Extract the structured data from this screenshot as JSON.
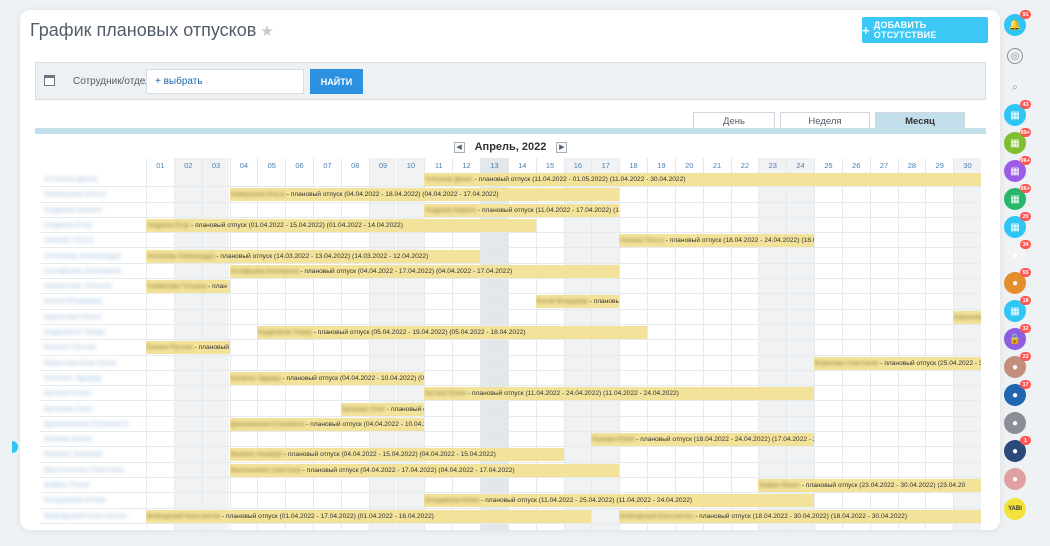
{
  "header": {
    "title": "График плановых отпусков",
    "add_label": "ДОБАВИТЬ ОТСУТСТВИЕ"
  },
  "filter": {
    "label": "Сотрудник/отдел:",
    "select_placeholder": "+ выбрать",
    "find_label": "НАЙТИ"
  },
  "tabs": [
    "День",
    "Неделя",
    "Месяц"
  ],
  "active_tab": "Месяц",
  "month_label": "Апрель, 2022",
  "days": [
    "01",
    "02",
    "03",
    "04",
    "05",
    "06",
    "07",
    "08",
    "09",
    "10",
    "11",
    "12",
    "13",
    "14",
    "15",
    "16",
    "17",
    "18",
    "19",
    "20",
    "21",
    "22",
    "23",
    "24",
    "25",
    "26",
    "27",
    "28",
    "29",
    "30"
  ],
  "weekends": [
    2,
    3,
    9,
    10,
    16,
    17,
    23,
    24,
    30
  ],
  "today": 13,
  "rows": [
    {
      "name": "Алтынов Денис",
      "bars": [
        {
          "start": 11,
          "end": 30,
          "who": "Алтынов Денис",
          "text": " - плановый отпуск (11.04.2022 - 01.05.2022) (11.04.2022 - 30.04.2022)"
        }
      ]
    },
    {
      "name": "Аникушина Ольга",
      "bars": [
        {
          "start": 4,
          "end": 17,
          "who": "Аникушина Ольга",
          "text": " - плановый отпуск (04.04.2022 - 18.04.2022) (04.04.2022 - 17.04.2022)"
        }
      ]
    },
    {
      "name": "Андреев Кирилл",
      "bars": [
        {
          "start": 11,
          "end": 17,
          "who": "Андреев Кирилл",
          "text": " - плановый отпуск (11.04.2022 - 17.04.2022) (11.04."
        }
      ]
    },
    {
      "name": "Андреев Егор",
      "bars": [
        {
          "start": 1,
          "end": 14,
          "who": "Андреев Егор",
          "text": " - плановый отпуск (01.04.2022 - 15.04.2022) (01.04.2022 - 14.04.2022)"
        }
      ]
    },
    {
      "name": "Аношко Ольга",
      "bars": [
        {
          "start": 18,
          "end": 24,
          "who": "Аношко Ольга",
          "text": " - плановый отпуск (18.04.2022 - 24.04.2022) (18.04.2"
        }
      ]
    },
    {
      "name": "Антонова Александра",
      "bars": [
        {
          "start": 1,
          "end": 12,
          "who": "Антонова Александра",
          "text": " - плановый отпуск (14.03.2022 - 13.04.2022) (14.03.2022 - 12.04.2022)"
        }
      ]
    },
    {
      "name": "Астафьева Екатерина",
      "bars": [
        {
          "start": 4,
          "end": 17,
          "who": "Астафьева Екатерина",
          "text": " - плановый отпуск (04.04.2022 - 17.04.2022) (04.04.2022 - 17.04.2022)"
        }
      ]
    },
    {
      "name": "Азаматова Татьяна",
      "bars": [
        {
          "start": 1,
          "end": 3,
          "who": "Азаматова Татьяна",
          "text": " - план"
        }
      ]
    },
    {
      "name": "Батов Владимир",
      "bars": [
        {
          "start": 15,
          "end": 17,
          "who": "Батов Владимир",
          "text": " - плановый"
        }
      ]
    },
    {
      "name": "Баранова Ольга",
      "bars": [
        {
          "start": 30,
          "end": 30,
          "who": "Баранова",
          "text": ""
        }
      ]
    },
    {
      "name": "Бадуханов Тимур",
      "bars": [
        {
          "start": 5,
          "end": 18,
          "who": "Бадуханов Тимур",
          "text": " - плановый отпуск (05.04.2022 - 19.04.2022) (05.04.2022 - 18.04.2022)"
        }
      ]
    },
    {
      "name": "Белкин Руслан",
      "bars": [
        {
          "start": 1,
          "end": 3,
          "who": "Белкин Руслан",
          "text": " - плановый с"
        }
      ]
    },
    {
      "name": "Борисова Анастасия",
      "bars": [
        {
          "start": 25,
          "end": 30,
          "who": "Борисова Анастасия",
          "text": " - плановый отпуск (25.04.2022 - 30.04"
        }
      ]
    },
    {
      "name": "Боленко Эдуард",
      "bars": [
        {
          "start": 4,
          "end": 10,
          "who": "Боленко Эдуард",
          "text": " - плановый отпуск (04.04.2022 - 10.04.2022) (04.04"
        }
      ]
    },
    {
      "name": "Бутина Юлия",
      "bars": [
        {
          "start": 11,
          "end": 24,
          "who": "Бутина Юлия",
          "text": " - плановый отпуск (11.04.2022 - 24.04.2022) (11.04.2022 - 24.04.2022)"
        }
      ]
    },
    {
      "name": "Бульман Олег",
      "bars": [
        {
          "start": 8,
          "end": 10,
          "who": "Бульман Олег",
          "text": " - плановый от"
        }
      ]
    },
    {
      "name": "Данилевская Елизавета",
      "bars": [
        {
          "start": 4,
          "end": 10,
          "who": "Данилевская Елизавета",
          "text": " - плановый отпуск (04.04.2022 - 10.04.2022"
        }
      ]
    },
    {
      "name": "Быкова Юлия",
      "bars": [
        {
          "start": 17,
          "end": 24,
          "who": "Быкова Юлия",
          "text": " - плановый отпуск (18.04.2022 - 24.04.2022) (17.04.2022 - 24.0"
        }
      ]
    },
    {
      "name": "Важина Эльвира",
      "bars": [
        {
          "start": 4,
          "end": 15,
          "who": "Важина Эльвира",
          "text": " - плановый отпуск (04.04.2022 - 15.04.2022) (04.04.2022 - 15.04.2022)"
        }
      ]
    },
    {
      "name": "Васильченко Светлана",
      "bars": [
        {
          "start": 4,
          "end": 17,
          "who": "Васильченко Светлана",
          "text": " - плановый отпуск (04.04.2022 - 17.04.2022) (04.04.2022 - 17.04.2022)"
        }
      ]
    },
    {
      "name": "Вафин Ренат",
      "bars": [
        {
          "start": 23,
          "end": 30,
          "who": "Вафин Ренат",
          "text": " - плановый отпуск (23.04.2022 - 30.04.2022) (23.04.20"
        }
      ]
    },
    {
      "name": "Владимова Юлия",
      "bars": [
        {
          "start": 11,
          "end": 24,
          "who": "Владимова Юлия",
          "text": " - плановый отпуск (11.04.2022 - 25.04.2022) (11.04.2022 - 24.04.2022)"
        }
      ]
    },
    {
      "name": "Войнарский Константин",
      "bars": [
        {
          "start": 1,
          "end": 16,
          "who": "Войнарский Константин",
          "text": " - плановый отпуск (01.04.2022 - 17.04.2022) (01.04.2022 - 16.04.2022)"
        },
        {
          "start": 18,
          "end": 30,
          "who": "Войнарский Константин",
          "text": " - плановый отпуск (18.04.2022 - 30.04.2022) (18.04.2022 - 30.04.2022)"
        }
      ]
    }
  ],
  "sidebar": [
    {
      "icon": "bell-icon",
      "color": "#2fc6f6",
      "badge": "91"
    },
    {
      "icon": "chat-icon",
      "color": "#a8adb4",
      "badge": ""
    },
    {
      "icon": "search-icon",
      "color": "#a8adb4",
      "badge": ""
    },
    {
      "icon": "calendar-icon",
      "color": "#2fc6f6",
      "badge": "43"
    },
    {
      "icon": "calendar-icon",
      "color": "#7fbf2f",
      "badge": "99+"
    },
    {
      "icon": "calendar-icon",
      "color": "#9b5de5",
      "badge": "96+"
    },
    {
      "icon": "calendar-icon",
      "color": "#28b66b",
      "badge": "96+"
    },
    {
      "icon": "calendar-icon",
      "color": "#2fc6f6",
      "badge": "20"
    },
    {
      "icon": "group-avatar-icon",
      "color": "#f1f3f4",
      "badge": "34"
    },
    {
      "icon": "group-avatar-icon",
      "color": "#e48d2c",
      "badge": "55"
    },
    {
      "icon": "calendar-icon",
      "color": "#2fc6f6",
      "badge": "18"
    },
    {
      "icon": "lock-icon",
      "color": "#8e5de0",
      "badge": "32"
    },
    {
      "icon": "user-avatar-icon",
      "color": "#c28f7c",
      "badge": "23"
    },
    {
      "icon": "group-avatar-icon",
      "color": "#2067b0",
      "badge": "17"
    },
    {
      "icon": "user-avatar-icon",
      "color": "#8a8f96",
      "badge": ""
    },
    {
      "icon": "group-avatar-icon",
      "color": "#2a4a7a",
      "badge": "1"
    },
    {
      "icon": "user-avatar-icon",
      "color": "#e0a0a0",
      "badge": ""
    },
    {
      "icon": "yabi-avatar-icon",
      "color": "#f2e33b",
      "badge": ""
    }
  ],
  "sidebar_yabi_text": "YABI"
}
